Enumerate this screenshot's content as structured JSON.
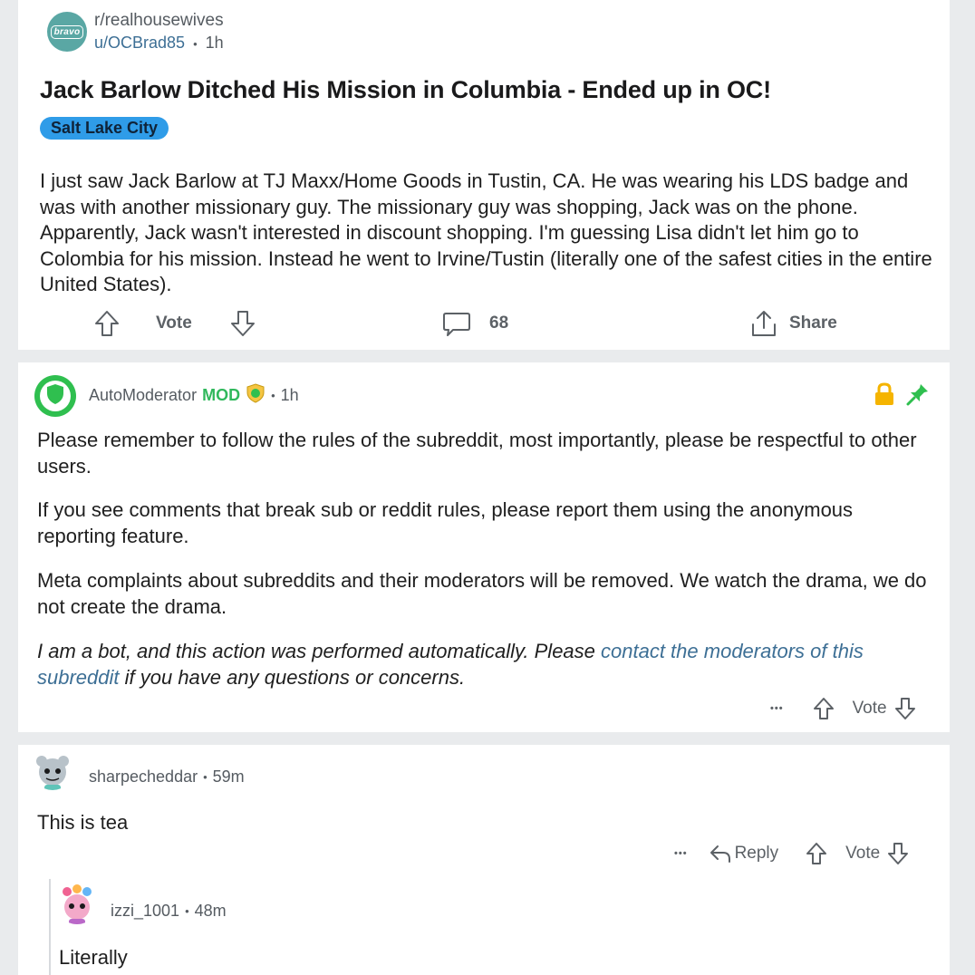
{
  "post": {
    "subreddit_avatar_text": "bravo",
    "subreddit": "r/realhousewives",
    "author": "u/OCBrad85",
    "separator": "•",
    "time": "1h",
    "title": "Jack Barlow Ditched His Mission in Columbia - Ended up in OC!",
    "flair": "Salt Lake City",
    "body": "I just saw Jack Barlow at TJ Maxx/Home Goods in Tustin, CA.  He was wearing his LDS badge and was with another missionary guy.  The missionary guy was shopping, Jack was on the phone.  Apparently, Jack wasn't interested in discount shopping.  I'm guessing Lisa didn't let him go to Colombia for his mission.  Instead he went to Irvine/Tustin (literally one of the safest cities in the entire United States).",
    "vote_label": "Vote",
    "comment_count": "68",
    "share_label": "Share"
  },
  "automod": {
    "author": "AutoModerator",
    "mod_tag": "MOD",
    "separator": "•",
    "time": "1h",
    "paragraph1": "Please remember to follow the rules of the subreddit, most importantly, please be respectful to other users.",
    "paragraph2": "If you see comments that break sub or reddit rules, please report them using the anonymous reporting feature.",
    "paragraph3": "Meta complaints about subreddits and their moderators will be removed. We watch the drama, we do not create the drama.",
    "bot_note_start": "I am a bot, and this action was performed automatically. Please ",
    "bot_note_link": "contact the moderators of this subreddit",
    "bot_note_end": " if you have any questions or concerns.",
    "more_label": "•••",
    "vote_label": "Vote"
  },
  "comment1": {
    "author": "sharpecheddar",
    "separator": "•",
    "time": "59m",
    "text": "This is tea",
    "more_label": "•••",
    "reply_label": "Reply",
    "vote_label": "Vote"
  },
  "reply1": {
    "author": "izzi_1001",
    "separator": "•",
    "time": "48m",
    "text": "Literally"
  },
  "colors": {
    "background": "#e9ebed",
    "card": "#ffffff",
    "flair_bg": "#2f9ce8",
    "link": "#3d6f95",
    "mod_green": "#30b85c",
    "lock": "#f5b400",
    "pin": "#2fbf4f"
  }
}
